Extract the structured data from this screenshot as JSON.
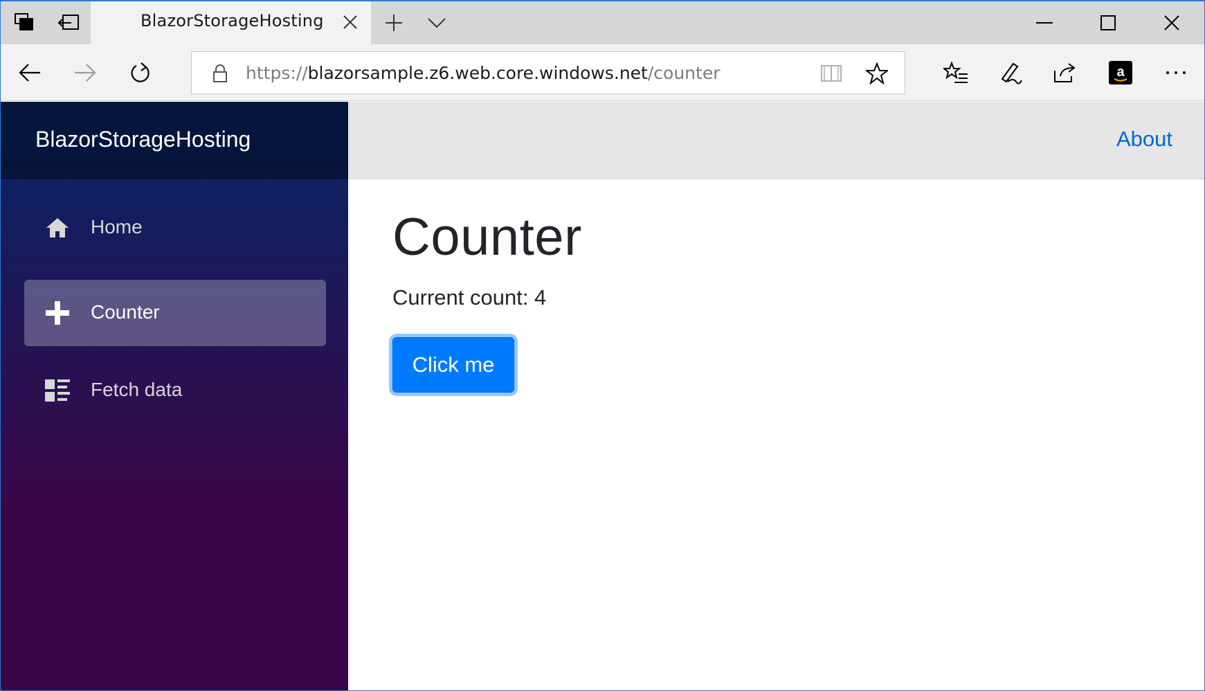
{
  "browser": {
    "tab_title": "BlazorStorageHosting",
    "url": {
      "scheme": "https://",
      "host": "blazorsample.z6.web.core.windows.net",
      "path": "/counter"
    }
  },
  "app": {
    "brand": "BlazorStorageHosting",
    "about_link": "About",
    "nav": [
      {
        "label": "Home",
        "icon": "home-icon",
        "active": false
      },
      {
        "label": "Counter",
        "icon": "plus-icon",
        "active": true
      },
      {
        "label": "Fetch data",
        "icon": "list-icon",
        "active": false
      }
    ],
    "page": {
      "title": "Counter",
      "count_prefix": "Current count: ",
      "count_value": "4",
      "button_label": "Click me"
    }
  },
  "colors": {
    "accent": "#007bff",
    "link": "#0366d6",
    "sidebar_top": "#052767",
    "sidebar_bottom": "#3a0647"
  }
}
